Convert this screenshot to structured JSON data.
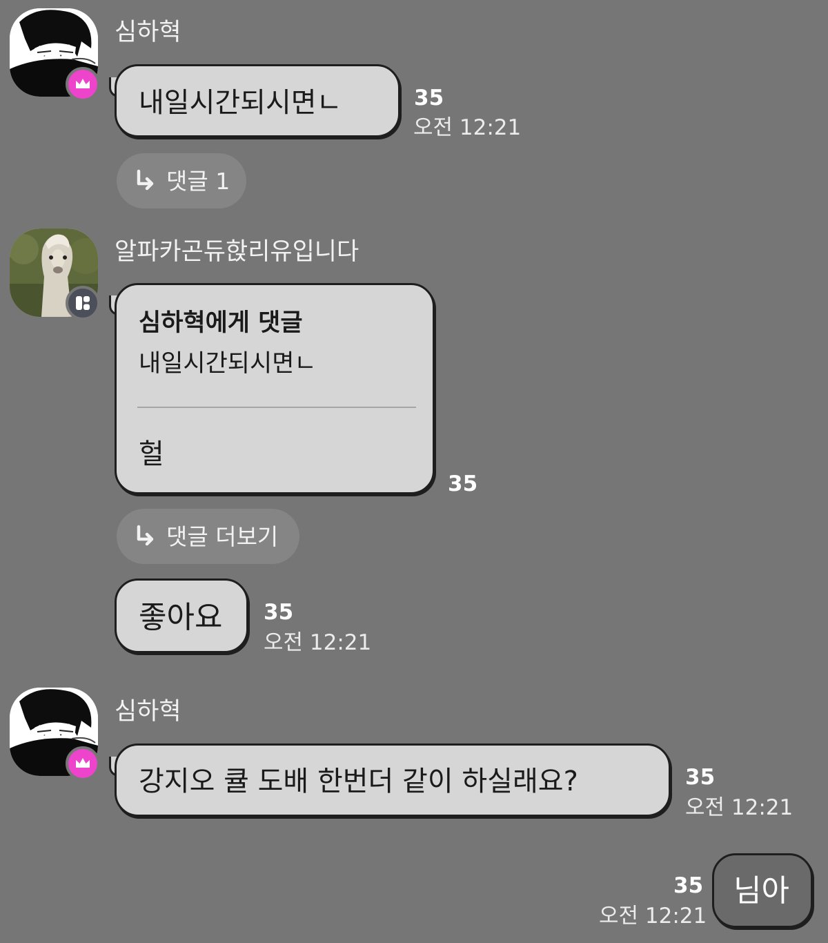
{
  "messages": [
    {
      "sender": "심하혁",
      "text": "내일시간되시면ㄴ",
      "read_count": "35",
      "time": "오전 12:21",
      "reply_label": "댓글 1"
    },
    {
      "sender": "알파카곤듀핝리유입니다",
      "reply_to_label": "심하혁에게 댓글",
      "quoted_text": "내일시간되시면ㄴ",
      "text": "헐",
      "read_count": "35",
      "reply_label": "댓글 더보기"
    },
    {
      "text": "좋아요",
      "read_count": "35",
      "time": "오전 12:21"
    },
    {
      "sender": "심하혁",
      "text": "강지오 큘 도배 한번더 같이 하실래요?",
      "read_count": "35",
      "time": "오전 12:21"
    }
  ],
  "my_message": {
    "text": "님아",
    "read_count": "35",
    "time": "오전 12:21"
  },
  "colors": {
    "background": "#767676",
    "bubble": "#d6d6d6",
    "my_bubble": "#6a6a6a",
    "crown_badge": "#ee44cc",
    "manager_badge": "#4a4f5a"
  },
  "icons": {
    "owner_badge": "crown-icon",
    "manager_badge": "manager-icon",
    "reply": "reply-arrow-icon"
  }
}
